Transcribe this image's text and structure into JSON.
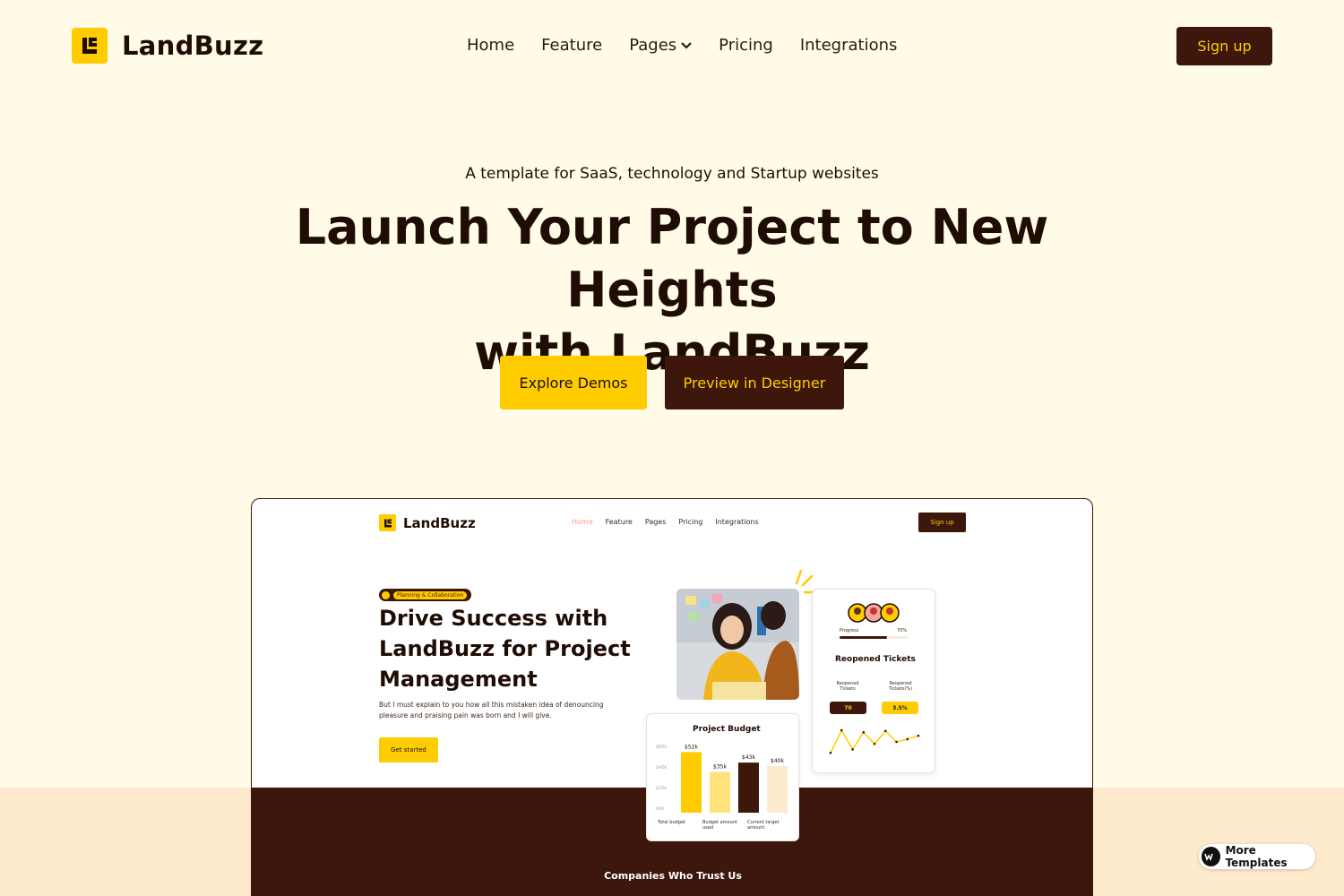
{
  "brand": {
    "name": "LandBuzz"
  },
  "nav": {
    "links": [
      "Home",
      "Feature",
      "Pages",
      "Pricing",
      "Integrations"
    ],
    "signup_label": "Sign up"
  },
  "hero": {
    "eyebrow": "A template for SaaS, technology and Startup websites",
    "title_line1": "Launch Your Project to New Heights",
    "title_line2": "with LandBuzz",
    "explore_label": "Explore Demos",
    "preview_label": "Preview in Designer"
  },
  "preview": {
    "brand": "LandBuzz",
    "nav_links": [
      "Home",
      "Feature",
      "Pages",
      "Pricing",
      "Integrations"
    ],
    "signup_label": "Sign up",
    "badge": "Planning & Collaboration",
    "title_line1": "Drive Success with",
    "title_line2": "LandBuzz for Project",
    "title_line3": "Management",
    "description": "But I must explain to you how all this mistaken idea of denouncing pleasure and praising pain was born and I will give.",
    "cta_label": "Get started",
    "tickets_card": {
      "progress_label": "Progress",
      "progress_value": "70%",
      "progress_fraction": 0.7,
      "title": "Reopened Tickets",
      "col1_label": "Reopened Tickets",
      "col2_label": "Reopened Tickets(%)",
      "col1_value": "70",
      "col2_value": "3.5%",
      "line_values": [
        25,
        58,
        30,
        55,
        38,
        57,
        41,
        45,
        50
      ],
      "line_labels": [
        "25",
        "58",
        "30",
        "57",
        "41",
        "45",
        "50"
      ]
    },
    "budget_card": {
      "title": "Project Budget",
      "y_ticks": [
        "$60k",
        "$40k",
        "$20k",
        "$0k"
      ],
      "bars": [
        {
          "label": "$52k",
          "value": 52,
          "color": "#ffcc00"
        },
        {
          "label": "$35k",
          "value": 35,
          "color": "#ffe27a"
        },
        {
          "label": "$43k",
          "value": 43,
          "color": "#3d170c"
        },
        {
          "label": "$40k",
          "value": 40,
          "color": "#fde9cc"
        }
      ],
      "legend": [
        "Total budget",
        "Budget amount used",
        "Current target amount"
      ]
    },
    "companies_label": "Companies Who Trust Us"
  },
  "badge_widget": {
    "label": "More Templates"
  },
  "colors": {
    "background": "#fffbe6",
    "accent": "#ffcc00",
    "dark": "#3d170c",
    "band": "#fde9cc"
  }
}
